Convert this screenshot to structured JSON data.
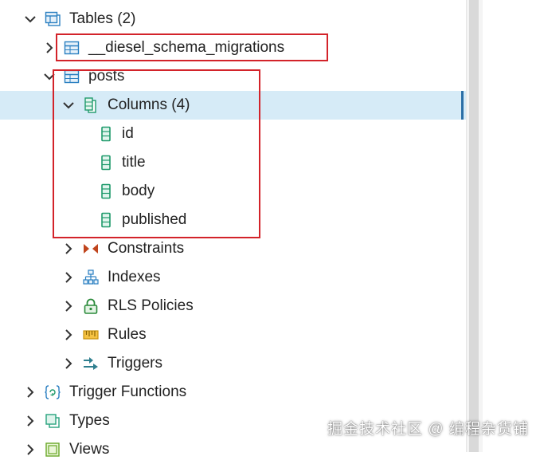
{
  "tree": {
    "tables_node": {
      "label": "Tables (2)",
      "expanded": true,
      "icon": "tables-icon"
    },
    "migrations_table": {
      "label": "__diesel_schema_migrations",
      "expanded": false,
      "icon": "table-icon"
    },
    "posts_table": {
      "label": "posts",
      "expanded": true,
      "icon": "table-icon"
    },
    "columns_node": {
      "label": "Columns (4)",
      "expanded": true,
      "selected": true,
      "icon": "columns-icon"
    },
    "columns": [
      {
        "label": "id",
        "icon": "column-icon"
      },
      {
        "label": "title",
        "icon": "column-icon"
      },
      {
        "label": "body",
        "icon": "column-icon"
      },
      {
        "label": "published",
        "icon": "column-icon"
      }
    ],
    "posts_children": [
      {
        "label": "Constraints",
        "icon": "constraints-icon"
      },
      {
        "label": "Indexes",
        "icon": "indexes-icon"
      },
      {
        "label": "RLS Policies",
        "icon": "lock-icon"
      },
      {
        "label": "Rules",
        "icon": "rules-icon"
      },
      {
        "label": "Triggers",
        "icon": "triggers-icon"
      }
    ],
    "schema_children": [
      {
        "label": "Trigger Functions",
        "icon": "trigger-functions-icon"
      },
      {
        "label": "Types",
        "icon": "types-icon"
      },
      {
        "label": "Views",
        "icon": "views-icon"
      }
    ]
  },
  "watermark": "掘金技术社区 @ 编程杂货铺",
  "colors": {
    "selection_bg": "#d6ebf7",
    "selection_bar": "#2b6ea6",
    "highlight_box": "#d3232a",
    "table_icon": "#2a7fc1",
    "column_icon": "#1e9a6b"
  }
}
